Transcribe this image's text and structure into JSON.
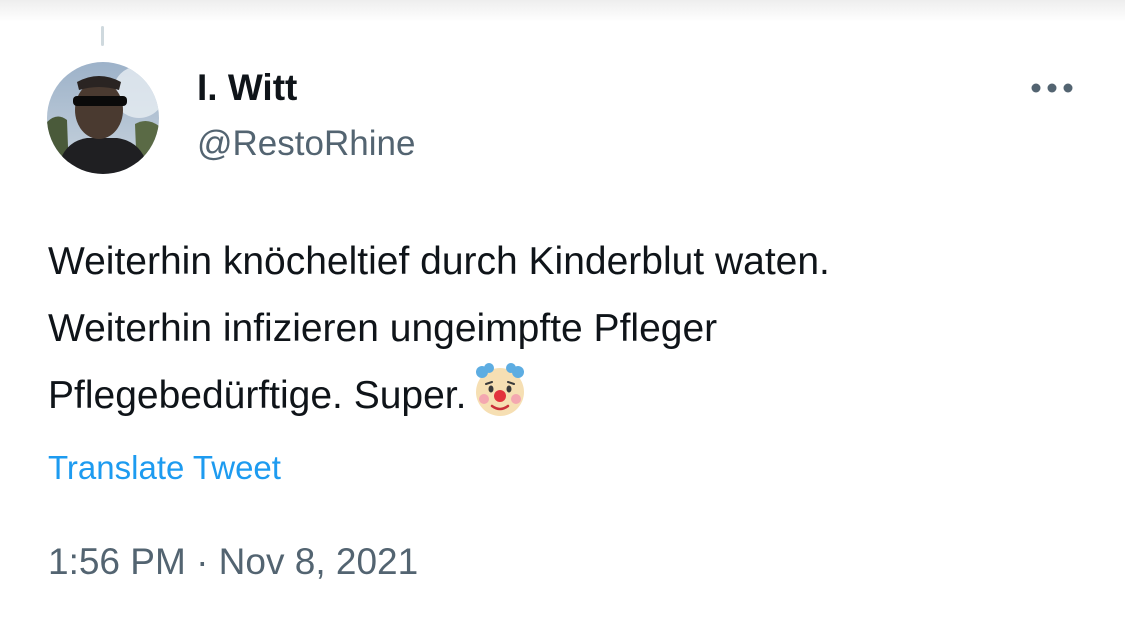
{
  "tweet": {
    "author": {
      "display_name": "I. Witt",
      "handle": "@RestoRhine"
    },
    "text": "Weiterhin knöcheltief durch Kinderblut waten.\nWeiterhin infizieren ungeimpfte Pfleger\nPflegebedürftige. Super.",
    "emoji": "clown-face-icon",
    "translate_label": "Translate Tweet",
    "timestamp": "1:56 PM · Nov 8, 2021"
  },
  "icons": {
    "more": "more-horizontal-icon",
    "avatar": "profile-photo"
  },
  "colors": {
    "text_primary": "#0f1419",
    "text_secondary": "#536471",
    "link": "#1d9bf0"
  }
}
